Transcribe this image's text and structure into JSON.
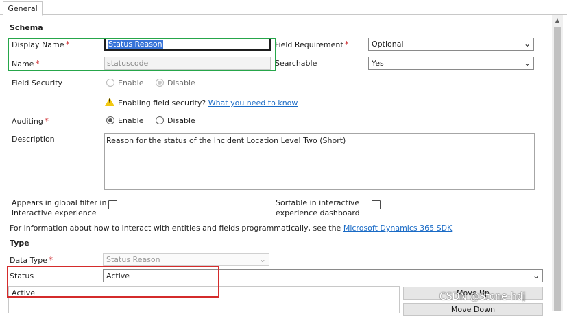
{
  "tabs": [
    {
      "label": "General"
    }
  ],
  "schema": {
    "heading": "Schema",
    "display_name_label": "Display Name",
    "display_name_value": "Status Reason",
    "name_label": "Name",
    "name_value": "statuscode",
    "field_requirement_label": "Field Requirement",
    "field_requirement_value": "Optional",
    "searchable_label": "Searchable",
    "searchable_value": "Yes",
    "field_security_label": "Field Security",
    "field_security_options": [
      "Enable",
      "Disable"
    ],
    "field_security_selected": "Disable",
    "warning_text": "Enabling field security?",
    "warning_link": "What you need to know",
    "auditing_label": "Auditing",
    "auditing_options": [
      "Enable",
      "Disable"
    ],
    "auditing_selected": "Enable",
    "description_label": "Description",
    "description_value": "Reason for the status of the Incident Location Level Two (Short)",
    "global_filter_label_1": "Appears in global filter in",
    "global_filter_label_2": "interactive experience",
    "sortable_label_1": "Sortable in interactive",
    "sortable_label_2": "experience dashboard",
    "info_text": "For information about how to interact with entities and fields programmatically, see the",
    "info_link": "Microsoft Dynamics 365 SDK",
    "required_marker": "*"
  },
  "type": {
    "heading": "Type",
    "data_type_label": "Data Type",
    "data_type_value": "Status Reason",
    "status_label": "Status",
    "status_value": "Active",
    "options_list": [
      "Active"
    ],
    "move_up_label": "Move Up",
    "move_down_label": "Move Down"
  },
  "watermark": "CSDN @Stone-hdj",
  "colors": {
    "highlight_green": "#26a64a",
    "highlight_red": "#d42b2b",
    "link": "#1a6bc6",
    "required": "#d13438"
  }
}
